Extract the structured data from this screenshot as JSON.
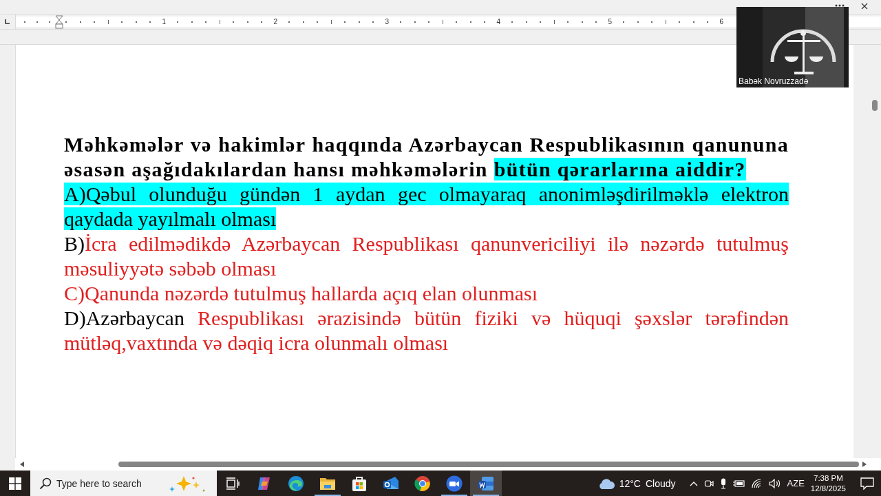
{
  "ruler": {
    "numbers": [
      "1",
      "2",
      "3",
      "4",
      "5",
      "6"
    ]
  },
  "document": {
    "paragraphs": [
      {
        "bold": true,
        "segments": [
          {
            "text": "Məhkəmələr və hakimlər haqqında Azərbaycan Respublikasının qanununa əsasən aşağıdakılardan hansı məhkəmələrin ",
            "highlighted": false,
            "color": "#000000"
          },
          {
            "text": "bütün qərarlarına aiddir?",
            "highlighted": true
          }
        ]
      },
      {
        "bold": false,
        "segments": [
          {
            "text": "A)Qəbul olunduğu gündən 1 aydan gec olmayaraq anonimləşdirilməklə elektron qaydada yayılmalı olması",
            "highlighted": true
          }
        ]
      },
      {
        "bold": false,
        "segments": [
          {
            "text": "B)",
            "highlighted": false,
            "color": "#000000"
          },
          {
            "text": "İcra edilmədikdə Azərbaycan Respublikası qanunvericiliyi ilə nəzərdə tutulmuş məsuliyyətə səbəb olması",
            "highlighted": false,
            "color": "#e02020"
          }
        ]
      },
      {
        "bold": false,
        "segments": [
          {
            "text": "C)Qanunda nəzərdə tutulmuş hallarda açıq elan olunması",
            "highlighted": false,
            "color": "#e02020"
          }
        ]
      },
      {
        "bold": false,
        "segments": [
          {
            "text": "D)Azərbaycan ",
            "highlighted": false,
            "color": "#000000"
          },
          {
            "text": "Respublikası ərazisində bütün fiziki və hüquqi şəxslər tərəfindən mütləq,vaxtında və dəqiq icra olunmalı olması",
            "highlighted": false,
            "color": "#e02020"
          }
        ]
      }
    ]
  },
  "video": {
    "name": "Babək Novruzzadə"
  },
  "taskbar": {
    "search": {
      "placeholder": "Type here to search"
    },
    "apps": [
      {
        "kind": "copilot",
        "running": false,
        "selected": false
      },
      {
        "kind": "edge",
        "running": false,
        "selected": false
      },
      {
        "kind": "explorer",
        "running": true,
        "selected": false
      },
      {
        "kind": "store",
        "running": false,
        "selected": false
      },
      {
        "kind": "outlook",
        "running": false,
        "selected": false
      },
      {
        "kind": "chrome",
        "running": false,
        "selected": false
      },
      {
        "kind": "zoom",
        "running": true,
        "selected": false
      },
      {
        "kind": "word",
        "running": true,
        "selected": true
      }
    ],
    "weather": {
      "temperature": "12°C",
      "condition": "Cloudy"
    },
    "language": "AZE",
    "time": "7:38 PM",
    "date": "12/8/2025"
  }
}
